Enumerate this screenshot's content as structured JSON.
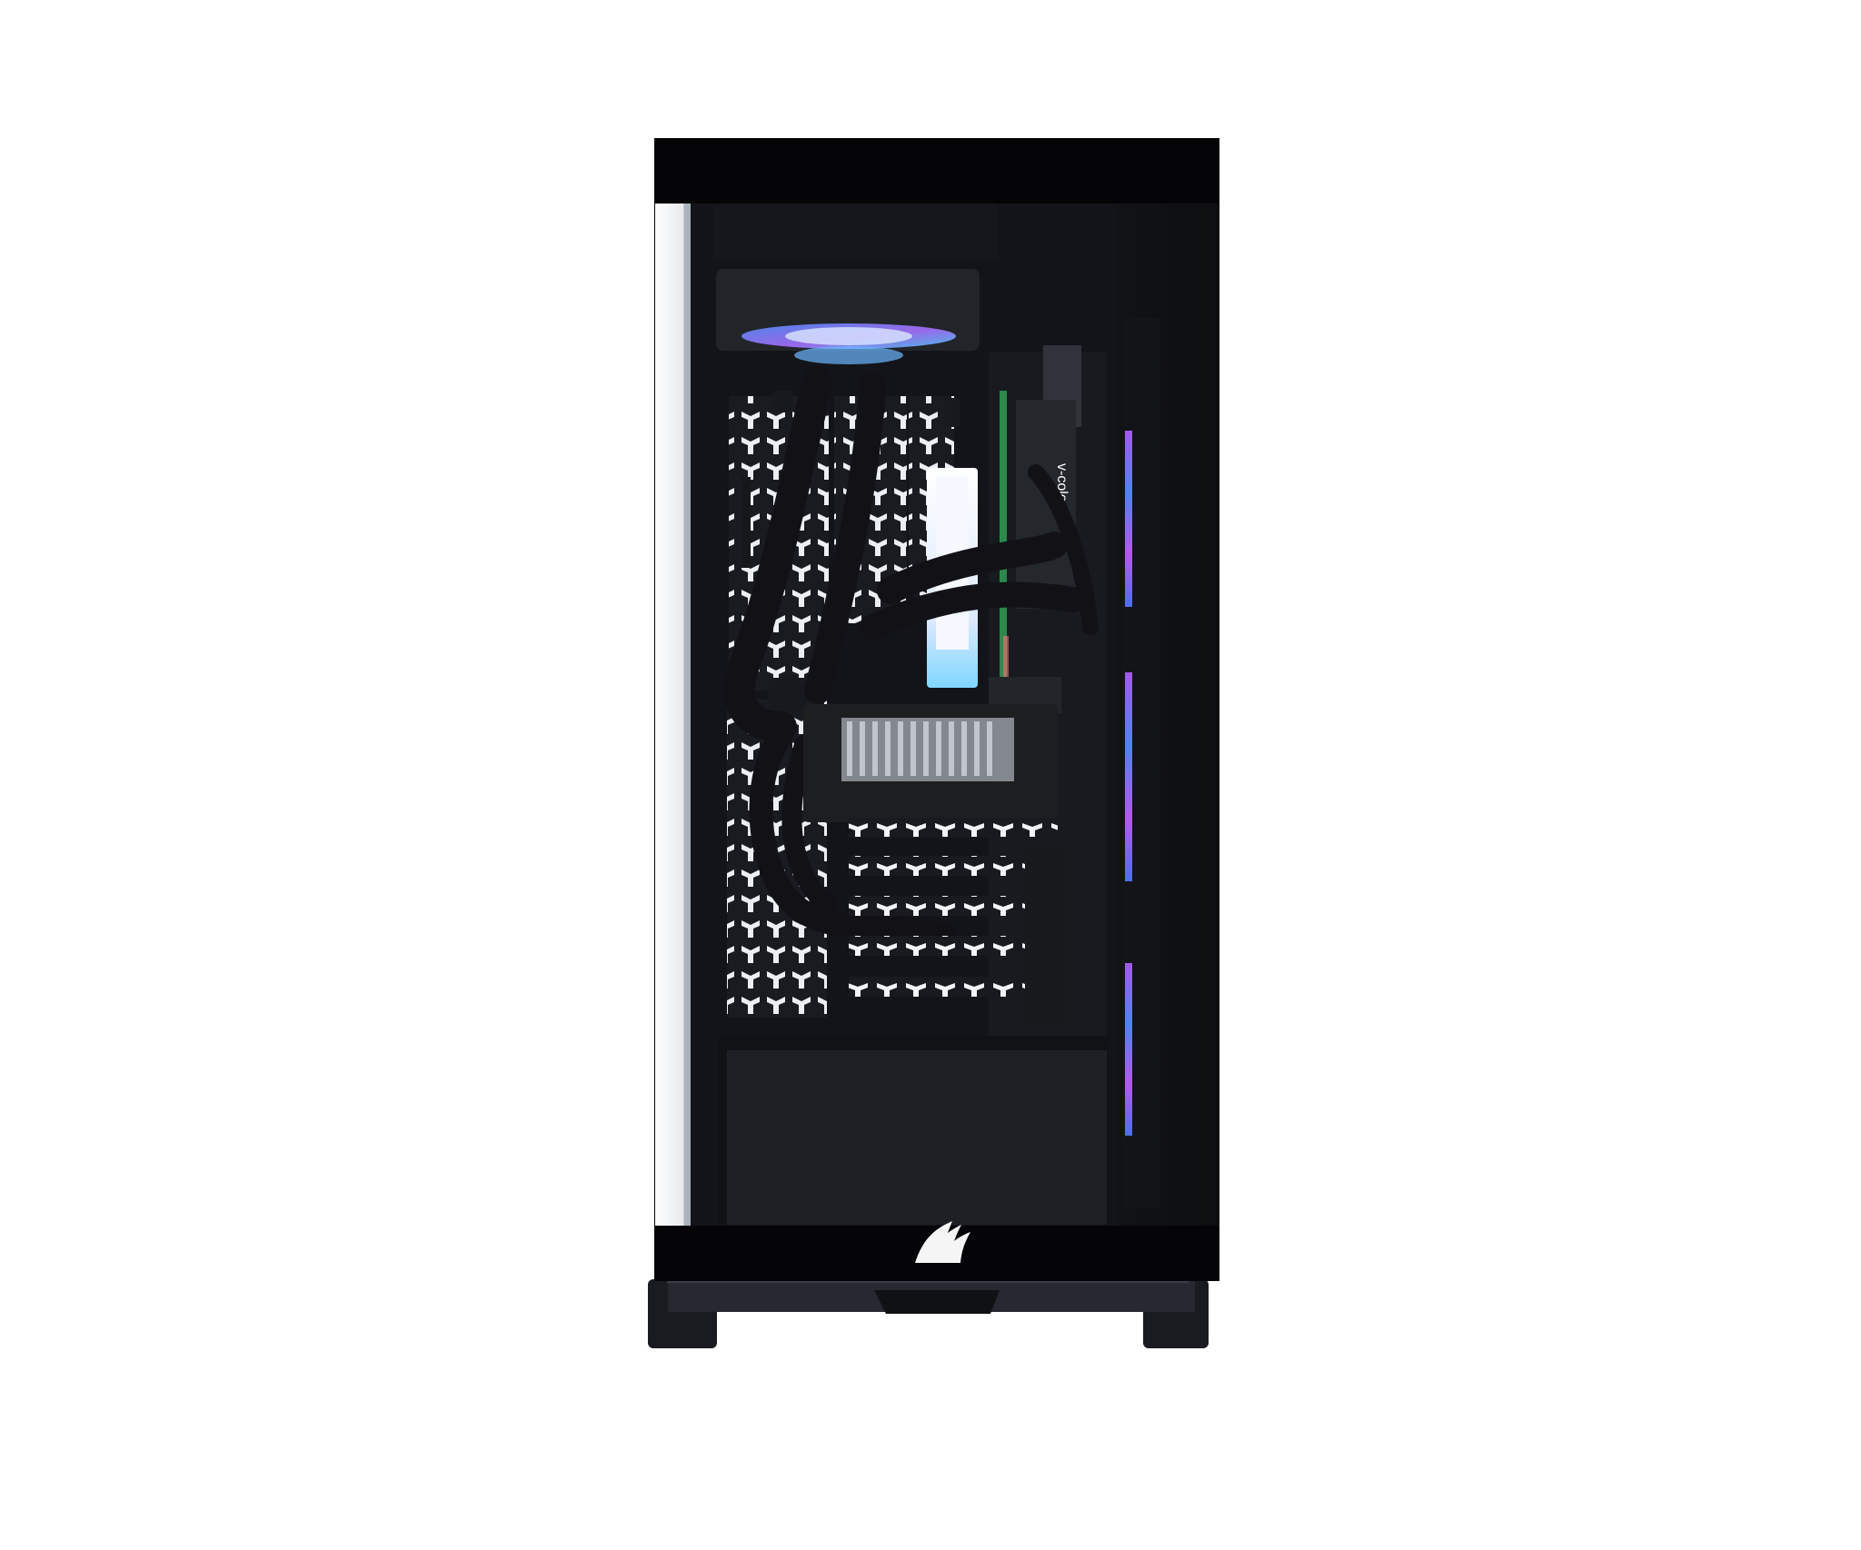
{
  "scene": {
    "subject": "pc-case-front-glass-view",
    "background_color": "#ffffff",
    "case_color": "#050507",
    "glass_tint_color": "#0b0d12",
    "panel_color": "#f2f4f6",
    "accent_blue": "#3c7cff",
    "accent_magenta": "#d050ff",
    "accent_green": "#37d26a",
    "logo_color": "#f5f5f5",
    "module_text": "v-color"
  }
}
